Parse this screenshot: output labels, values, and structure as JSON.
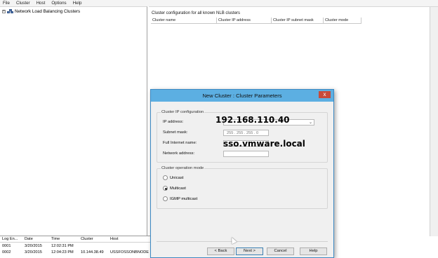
{
  "menubar": {
    "items": [
      "File",
      "Cluster",
      "Host",
      "Options",
      "Help"
    ]
  },
  "tree": {
    "expander": "+",
    "root_label": "Network Load Balancing Clusters",
    "root_icon": "cluster-icon"
  },
  "right_pane": {
    "header": "Cluster configuration for all known NLB clusters",
    "columns": [
      "Cluster name",
      "Cluster IP address",
      "Cluster IP subnet mask",
      "Cluster mode"
    ]
  },
  "log": {
    "columns": [
      "Log En...",
      "Date",
      "Time",
      "Cluster",
      "Host"
    ],
    "rows": [
      [
        "0001",
        "3/20/2015",
        "12:02:31 PM",
        "",
        ""
      ],
      [
        "0002",
        "3/20/2015",
        "12:04:23 PM",
        "10.144.38.49",
        "USSFOSSONBNODE"
      ]
    ]
  },
  "dialog": {
    "title": "New Cluster : Cluster Parameters",
    "close_glyph": "x",
    "ip_group": {
      "legend": "Cluster IP configuration",
      "ip_label": "IP address:",
      "ip_value": "192.168.110.40",
      "mask_label": "Subnet mask:",
      "mask_value": "255 . 255 . 255 . 0",
      "fqdn_label": "Full Internet name:",
      "fqdn_value": "sso.vmware.local",
      "network_label": "Network address:"
    },
    "mode_group": {
      "legend": "Cluster operation mode",
      "options": [
        "Unicast",
        "Multicast",
        "IGMP multicast"
      ],
      "selected": "Multicast"
    },
    "buttons": {
      "back": "< Back",
      "next": "Next >",
      "cancel": "Cancel",
      "help": "Help"
    }
  },
  "colors": {
    "title_bar": "#5cafe2",
    "close_button": "#c84a3a",
    "dialog_bg": "#f0f0f0"
  }
}
